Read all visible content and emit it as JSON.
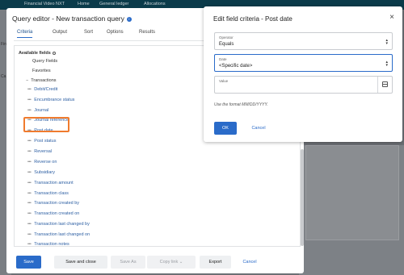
{
  "background": {
    "topbar_items": [
      "Financial Video NXT",
      "Home",
      "General ledger",
      "Allocations"
    ],
    "left_letters": [
      "Fin",
      "Ca"
    ]
  },
  "query_editor": {
    "title": "Query editor - New transaction query",
    "info_icon": "info-icon",
    "tabs": [
      "Criteria",
      "Output",
      "Sort",
      "Options",
      "Results"
    ],
    "active_tab": "Criteria",
    "fields_header": "Available fields",
    "top_items": [
      "Query Fields",
      "Favorites"
    ],
    "group": "Transactions",
    "leaves": [
      "Debit/Credit",
      "Encumbrance status",
      "Journal",
      "Journal reference",
      "Post date",
      "Post status",
      "Reversal",
      "Reverse on",
      "Subsidiary",
      "Transaction amount",
      "Transaction class",
      "Transaction created by",
      "Transaction created on",
      "Transaction last changed by",
      "Transaction last changed on",
      "Transaction notes"
    ],
    "highlighted_leaf": "Post date",
    "footer": {
      "save": "Save",
      "save_close": "Save and close",
      "save_as": "Save As",
      "copy_link": "Copy link",
      "export": "Export",
      "cancel": "Cancel"
    }
  },
  "criteria_modal": {
    "title": "Edit field criteria - Post date",
    "close_icon": "close-icon",
    "operator": {
      "label": "Operator",
      "value": "Equals"
    },
    "date": {
      "label": "Date",
      "value": "<Specific date>"
    },
    "value": {
      "label": "Value",
      "value": ""
    },
    "hint": "Use the format MM/DD/YYYY.",
    "ok": "OK",
    "cancel": "Cancel"
  },
  "colors": {
    "primary": "#2a6bc9",
    "highlight": "#f07b2e",
    "link": "#2d5fa3"
  }
}
